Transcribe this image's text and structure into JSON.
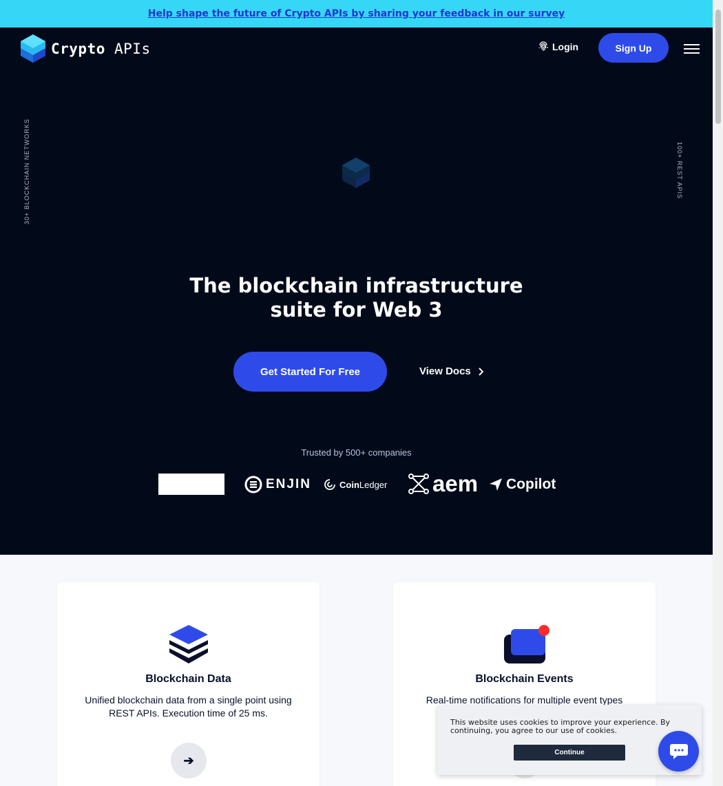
{
  "banner": {
    "text": "Help shape the future of Crypto APIs by sharing your feedback in our survey"
  },
  "header": {
    "logo_main": "Crypto",
    "logo_suffix": "APIs",
    "login_label": "Login",
    "signup_label": "Sign Up",
    "login_icon": "fingerprint-icon",
    "menu_icon": "hamburger-menu-icon"
  },
  "side": {
    "left_text": "30+ BLOCKCHAIN NETWORKS",
    "right_text": "100+ REST APIS"
  },
  "hero": {
    "title_line1": "The blockchain infrastructure",
    "title_line2": "suite for Web 3",
    "cta_label": "Get Started For Free",
    "docs_label": "View Docs"
  },
  "trusted": {
    "label": "Trusted by 500+ companies",
    "logos": [
      "ENJIN",
      "CoinLedger",
      "aem",
      "Copilot"
    ],
    "coinledger_bold": "Coin",
    "coinledger_rest": "Ledger"
  },
  "cards": [
    {
      "title": "Blockchain Data",
      "desc": "Unified blockchain data from a single point using REST APIs. Execution time of 25 ms.",
      "icon": "stacked-layers-icon",
      "arrow": "➔"
    },
    {
      "title": "Blockchain Events",
      "desc": "Real-time notifications for multiple event types",
      "icon": "notification-window-icon",
      "arrow": "➔"
    }
  ],
  "cookie": {
    "text": "This website uses cookies to improve your experience. By continuing, you agree to our use of cookies.",
    "button_label": "Continue"
  },
  "colors": {
    "background": "#020a1a",
    "accent": "#2e4bea",
    "banner": "#36d7f6",
    "banner_text": "#1d37d6",
    "notification_dot": "#ff2a2a"
  }
}
